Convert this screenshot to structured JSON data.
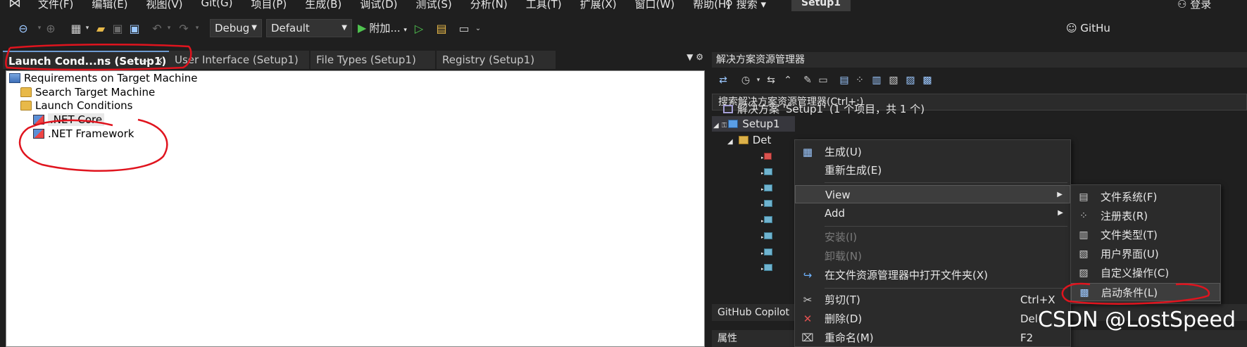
{
  "menubar": {
    "items": [
      "文件(F)",
      "编辑(E)",
      "视图(V)",
      "Git(G)",
      "项目(P)",
      "生成(B)",
      "调试(D)",
      "测试(S)",
      "分析(N)",
      "工具(T)",
      "扩展(X)",
      "窗口(W)",
      "帮助(H)"
    ],
    "search": "搜索",
    "project": "Setup1",
    "login": "登录"
  },
  "toolbar": {
    "config": "Debug",
    "platform": "Default",
    "attach": "附加...",
    "github": "GitHu"
  },
  "doctabs": [
    {
      "label": "Launch Cond...ns (Setup1)",
      "active": true
    },
    {
      "label": "User Interface (Setup1)",
      "active": false
    },
    {
      "label": "File Types (Setup1)",
      "active": false
    },
    {
      "label": "Registry (Setup1)",
      "active": false
    }
  ],
  "tree": {
    "root": "Requirements on Target Machine",
    "search": "Search Target Machine",
    "launch": "Launch Conditions",
    "netcore": ".NET Core",
    "netfx": ".NET Framework"
  },
  "solution": {
    "header": "解决方案资源管理器",
    "search": "搜索解决方案资源管理器(Ctrl+;)",
    "solution_row": "解决方案 'Setup1' (1 个项目，共 1 个)",
    "project_row": "Setup1",
    "folder_row": "Det",
    "copilot": "GitHub Copilot",
    "properties": "属性"
  },
  "context_menu": {
    "build": "生成(U)",
    "rebuild": "重新生成(E)",
    "view": "View",
    "add": "Add",
    "install": "安装(I)",
    "uninstall": "卸载(N)",
    "open_folder": "在文件资源管理器中打开文件夹(X)",
    "cut": "剪切(T)",
    "cut_sc": "Ctrl+X",
    "delete": "删除(D)",
    "delete_sc": "Del",
    "rename": "重命名(M)",
    "rename_sc": "F2"
  },
  "submenu": {
    "filesystem": "文件系统(F)",
    "registry": "注册表(R)",
    "filetypes": "文件类型(T)",
    "ui": "用户界面(U)",
    "custom": "自定义操作(C)",
    "launch": "启动条件(L)"
  },
  "watermark": "CSDN @LostSpeed"
}
